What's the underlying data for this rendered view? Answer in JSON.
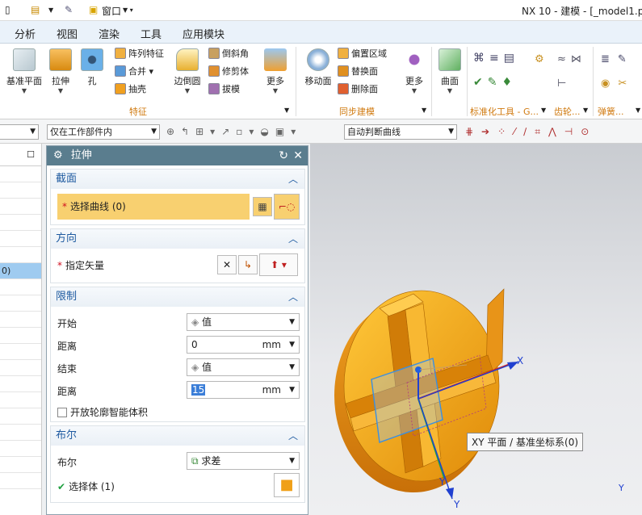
{
  "window": {
    "title": "NX 10 - 建模 - [_model1.p"
  },
  "quick_access": {
    "window_menu": "窗口"
  },
  "menu": [
    "分析",
    "视图",
    "渲染",
    "工具",
    "应用模块"
  ],
  "ribbon": {
    "datum_plane": "基准平面",
    "extrude": "拉伸",
    "hole": "孔",
    "pattern_feature": "阵列特征",
    "unite": "合并",
    "shell": "抽壳",
    "edge_blend": "边倒圆",
    "chamfer": "倒斜角",
    "trim_body": "修剪体",
    "draft": "拔模",
    "more1": "更多",
    "move_face": "移动面",
    "offset_region": "偏置区域",
    "replace_face": "替换面",
    "delete_face": "删除面",
    "more2": "更多",
    "surface": "曲面",
    "group_feature": "特征",
    "group_sync": "同步建模",
    "group_std": "标准化工具 - G...",
    "group_gear": "齿轮...",
    "group_spring": "弹簧..."
  },
  "toolbar2": {
    "scope": "仅在工作部件内",
    "curve_rule": "自动判断曲线"
  },
  "left_panel": {
    "selected_item": "0)"
  },
  "dialog": {
    "title": "拉伸",
    "section": {
      "heading": "截面",
      "select_curve": "选择曲线 (0)"
    },
    "direction": {
      "heading": "方向",
      "specify_vector": "指定矢量"
    },
    "limits": {
      "heading": "限制",
      "start_label": "开始",
      "start_value": "值",
      "distance_label": "距离",
      "start_distance": "0",
      "end_label": "结束",
      "end_value": "值",
      "end_distance": "15",
      "unit": "mm",
      "unit2": "mm",
      "open_profile": "开放轮廓智能体积"
    },
    "boolean": {
      "heading": "布尔",
      "label": "布尔",
      "value": "求差",
      "select_body": "选择体 (1)"
    }
  },
  "viewport": {
    "tooltip": "XY 平面 / 基准坐标系(0)",
    "axis_x": "X",
    "axis_y": "Y",
    "axis_y2": "Y",
    "axis_y3": "Y"
  },
  "colors": {
    "accent": "#1e5aa0",
    "dialog_title": "#5a7d8e",
    "required_field": "#f8d070",
    "model": "#f0a018"
  }
}
